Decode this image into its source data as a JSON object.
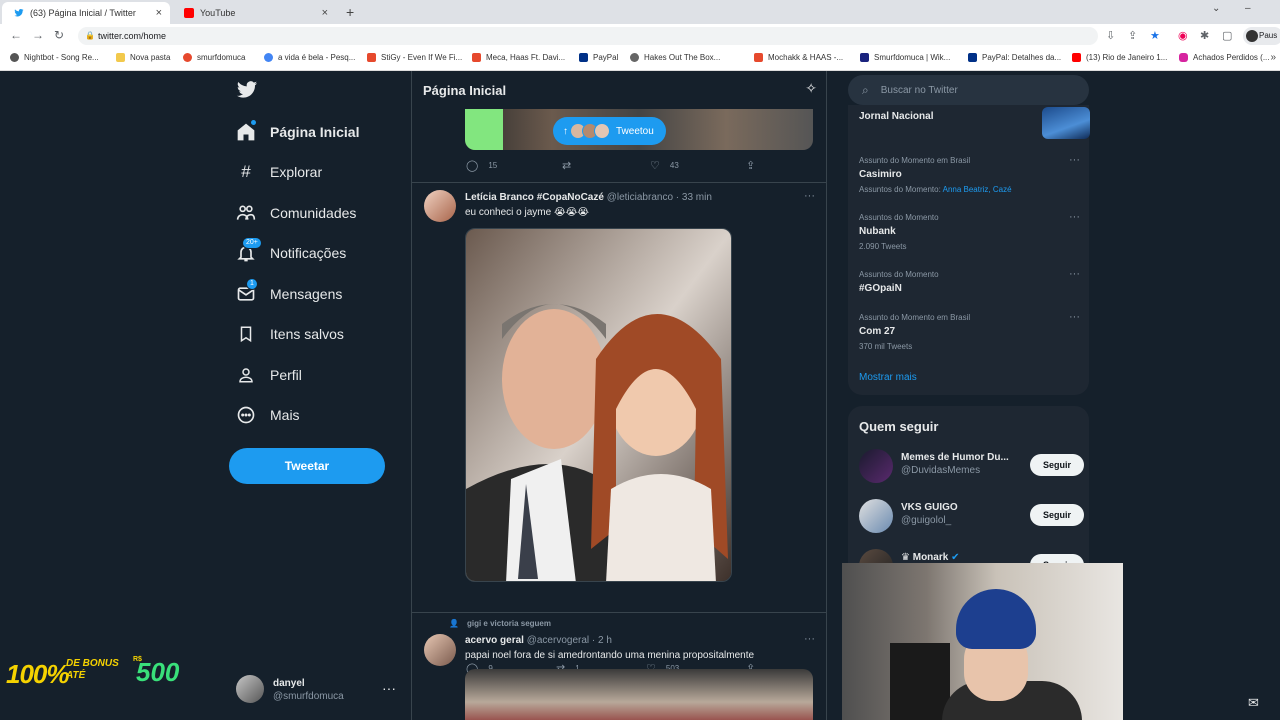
{
  "browser": {
    "tabs": [
      {
        "title": "(63) Página Inicial / Twitter",
        "close": "×"
      },
      {
        "title": "YouTube",
        "close": "×"
      }
    ],
    "new_tab": "+",
    "url": "twitter.com/home",
    "profile": "Paus",
    "bookmarks": [
      "Nightbot - Song Re...",
      "Nova pasta",
      "smurfdomuca",
      "a vida é bela - Pesq...",
      "StiGy - Even If We Fi...",
      "Meca, Haas Ft. Davi...",
      "PayPal",
      "Hakes Out The Box...",
      "Mochakk & HAAS -...",
      "Smurfdomuca | Wik...",
      "PayPal: Detalhes da...",
      "(13) Rio de Janeiro 1...",
      "Achados Perdidos (..."
    ],
    "bookmarks_more": "»"
  },
  "sidebar": {
    "items": [
      {
        "label": "Página Inicial",
        "badge": ""
      },
      {
        "label": "Explorar",
        "badge": ""
      },
      {
        "label": "Comunidades",
        "badge": ""
      },
      {
        "label": "Notificações",
        "badge": "20+"
      },
      {
        "label": "Mensagens",
        "badge": "1"
      },
      {
        "label": "Itens salvos",
        "badge": ""
      },
      {
        "label": "Perfil",
        "badge": ""
      },
      {
        "label": "Mais",
        "badge": ""
      }
    ],
    "tweet_button": "Tweetar",
    "account": {
      "name": "danyel",
      "handle": "@smurfdomuca",
      "more": "···"
    }
  },
  "promo": {
    "percent": "100%",
    "line1": "DE BONUS",
    "line2": "ATÉ",
    "currency": "R$",
    "amount": "500"
  },
  "timeline": {
    "title": "Página Inicial",
    "tweetou_label": "Tweetou",
    "prev_actions": {
      "replies": "15",
      "retweets": "",
      "likes": "43"
    },
    "tweets": [
      {
        "name": "Letícia Branco #CopaNoCazé",
        "handle": "@leticiabranco",
        "time": "· 33 min",
        "text": "eu conheci o jayme 😭😭😭",
        "replies": "9",
        "retweets": "1",
        "likes": "503"
      },
      {
        "social": "gigi e victoria seguem",
        "name": "acervo geral",
        "handle": "@acervogeral",
        "time": "· 2 h",
        "text": "papai noel fora de si amedrontando uma menina propositalmente"
      }
    ]
  },
  "right": {
    "search_placeholder": "Buscar no Twitter",
    "trends": [
      {
        "meta": "",
        "name": "Jornal Nacional",
        "sub": "",
        "links": ""
      },
      {
        "meta": "Assunto do Momento em Brasil",
        "name": "Casimiro",
        "sub": "Assuntos do Momento:",
        "links": "Anna Beatriz, Cazé"
      },
      {
        "meta": "Assuntos do Momento",
        "name": "Nubank",
        "sub": "2.090 Tweets",
        "links": ""
      },
      {
        "meta": "Assuntos do Momento",
        "name": "#GOpaiN",
        "sub": "",
        "links": ""
      },
      {
        "meta": "Assunto do Momento em Brasil",
        "name": "Com 27",
        "sub": "370 mil Tweets",
        "links": ""
      }
    ],
    "show_more": "Mostrar mais",
    "who_to_follow": "Quem seguir",
    "follow": [
      {
        "name": "Memes de Humor Du...",
        "handle": "@DuvidasMemes",
        "button": "Seguir"
      },
      {
        "name": "VKS GUIGO",
        "handle": "@guigolol_",
        "button": "Seguir"
      },
      {
        "name": "♛ Monark",
        "handle": "",
        "button": "Seguir"
      }
    ]
  },
  "colors": {
    "accent": "#1d9bf0",
    "bg": "#15202b",
    "card": "#1e2732"
  }
}
